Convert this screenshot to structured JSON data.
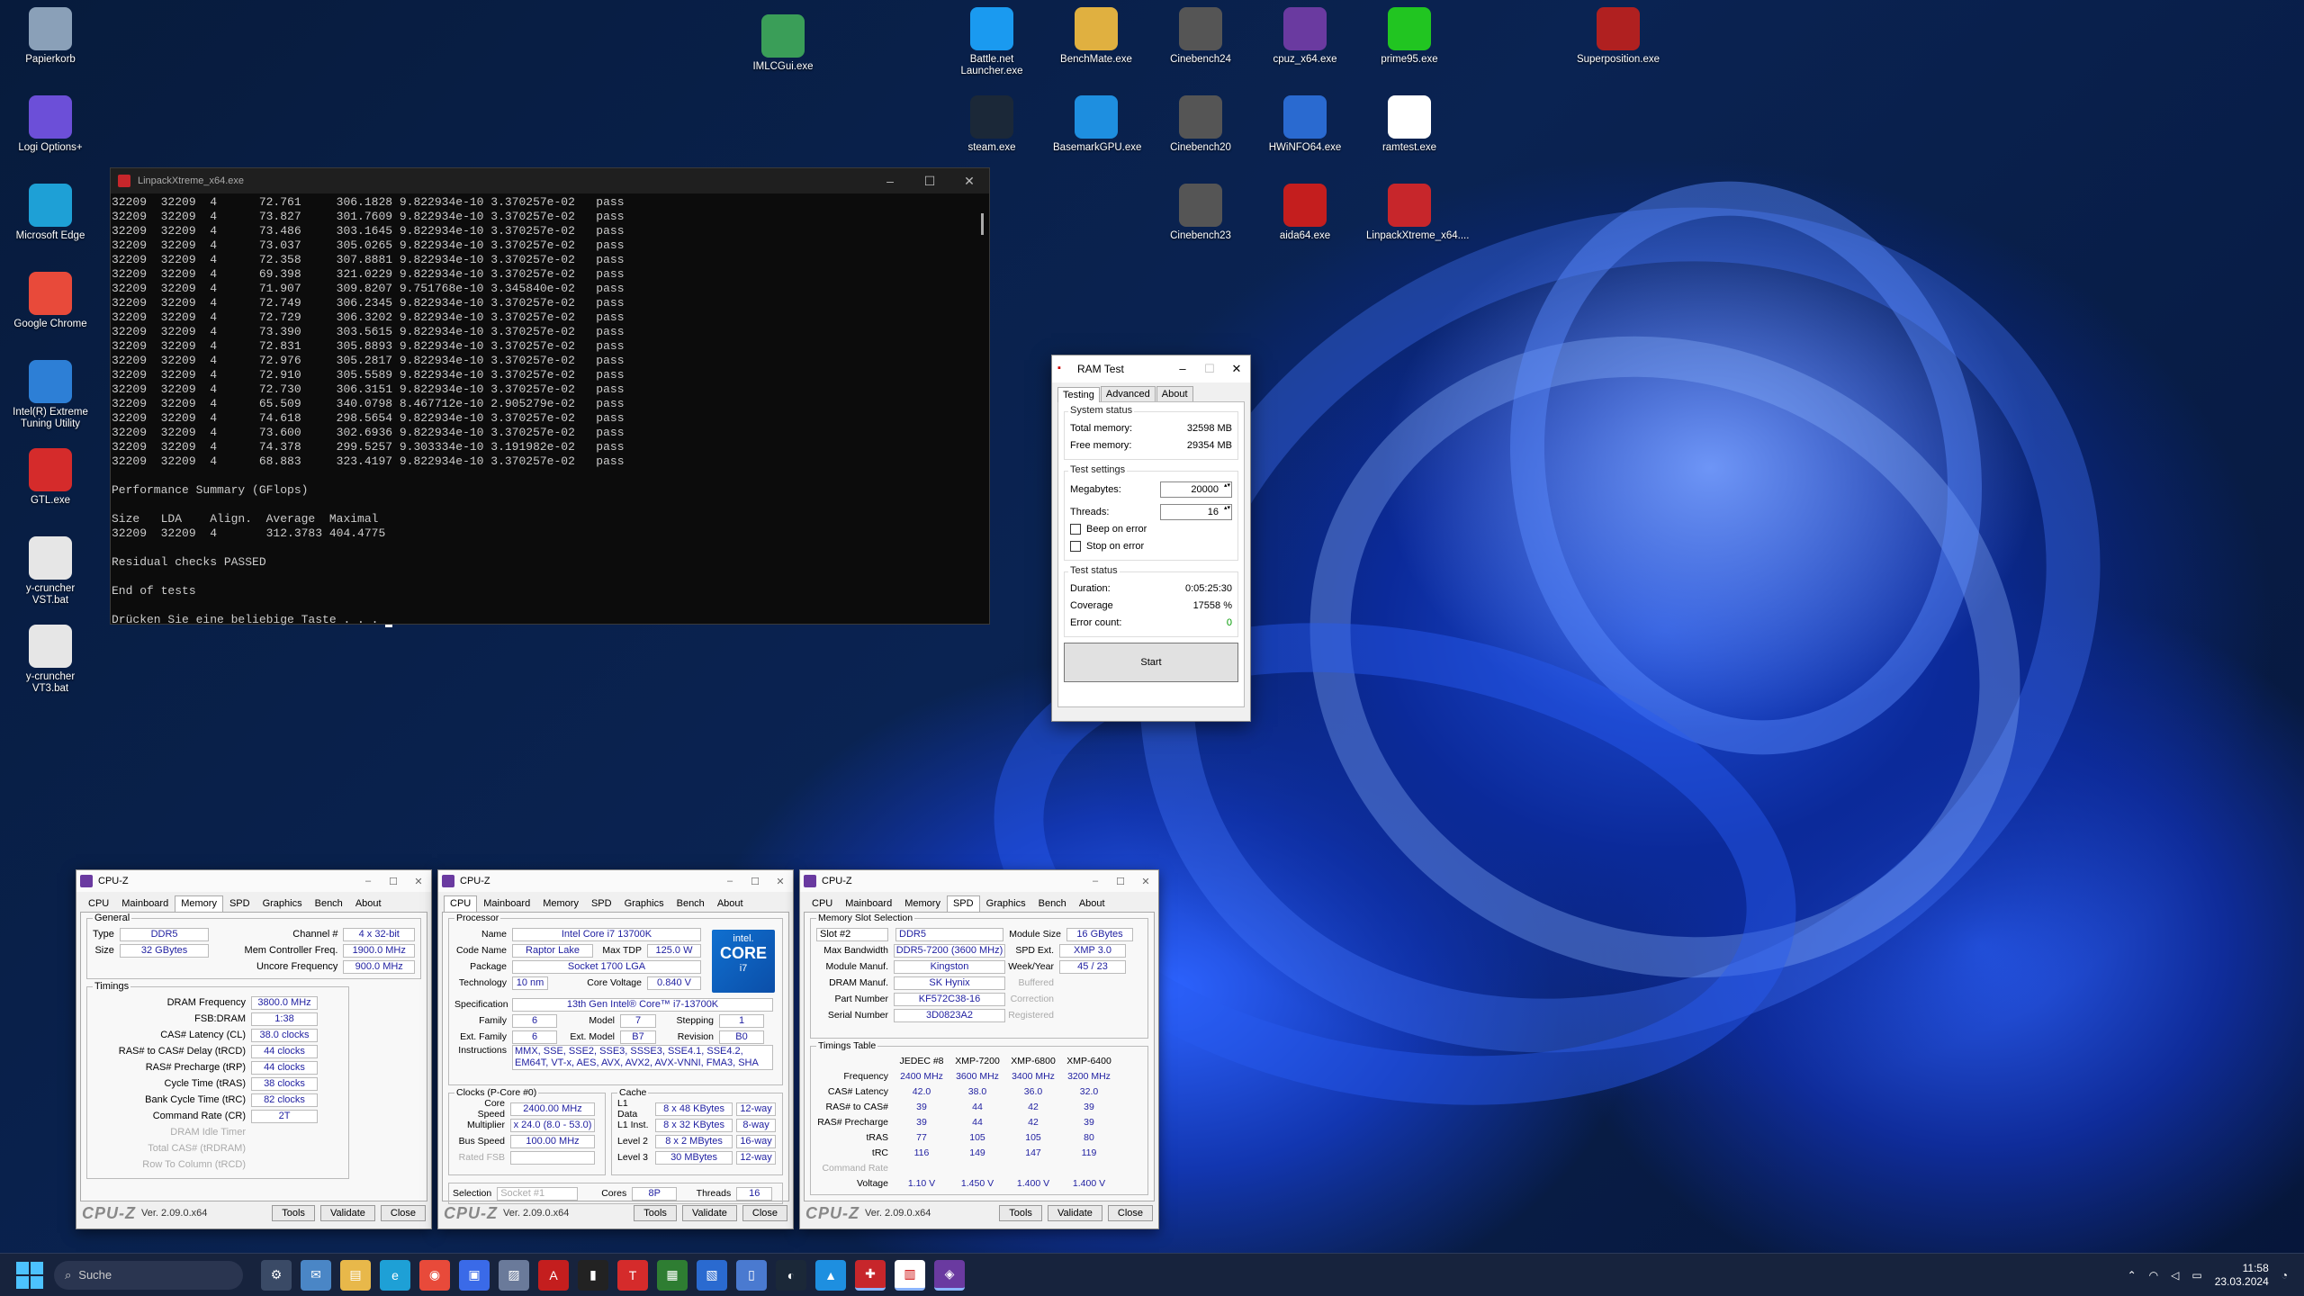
{
  "desktop_icons": [
    {
      "label": "Papierkorb",
      "icon": "recycle-bin-icon",
      "color": "#8aa0b8"
    },
    {
      "label": "Logi Options+",
      "icon": "logi-icon",
      "color": "#6c4fd8"
    },
    {
      "label": "Microsoft Edge",
      "icon": "edge-icon",
      "color": "#1ea0d6"
    },
    {
      "label": "Google Chrome",
      "icon": "chrome-icon",
      "color": "#e84a3a"
    },
    {
      "label": "Intel(R) Extreme Tuning Utility",
      "icon": "xtu-icon",
      "color": "#2d7fd6"
    },
    {
      "label": "GTL.exe",
      "icon": "gtl-icon",
      "color": "#d52b2b"
    },
    {
      "label": "y-cruncher VST.bat",
      "icon": "bat-gear-icon",
      "color": "#e6e6e6"
    },
    {
      "label": "y-cruncher VT3.bat",
      "icon": "bat-gear-icon",
      "color": "#e6e6e6"
    },
    {
      "label": "IMLCGui.exe",
      "icon": "memory-icon",
      "color": "#3a9e58"
    },
    {
      "label": "Battle.net Launcher.exe",
      "icon": "battlenet-icon",
      "color": "#1a9af0"
    },
    {
      "label": "BenchMate.exe",
      "icon": "benchmate-icon",
      "color": "#e0b040"
    },
    {
      "label": "Cinebench24",
      "icon": "cinebench-icon",
      "color": "#555"
    },
    {
      "label": "cpuz_x64.exe",
      "icon": "cpuz-icon",
      "color": "#6a3aa0"
    },
    {
      "label": "prime95.exe",
      "icon": "prime95-icon",
      "color": "#21c521"
    },
    {
      "label": "Superposition.exe",
      "icon": "superposition-icon",
      "color": "#b02020"
    },
    {
      "label": "steam.exe",
      "icon": "steam-icon",
      "color": "#1b2838"
    },
    {
      "label": "BasemarkGPU.exe",
      "icon": "basemark-icon",
      "color": "#1e8fe0"
    },
    {
      "label": "Cinebench20",
      "icon": "cinebench-icon",
      "color": "#555"
    },
    {
      "label": "HWiNFO64.exe",
      "icon": "hwinfo-icon",
      "color": "#2a6ad0"
    },
    {
      "label": "ramtest.exe",
      "icon": "ramtest-icon",
      "color": "#ffffff"
    },
    {
      "label": "Cinebench23",
      "icon": "cinebench-icon",
      "color": "#555"
    },
    {
      "label": "aida64.exe",
      "icon": "aida64-icon",
      "color": "#c41e1e"
    },
    {
      "label": "LinpackXtreme_x64....",
      "icon": "linpack-icon",
      "color": "#c7262b"
    }
  ],
  "terminal": {
    "title": "LinpackXtreme_x64.exe",
    "lines": [
      "32209  32209  4      72.761     306.1828 9.822934e-10 3.370257e-02   pass",
      "32209  32209  4      73.827     301.7609 9.822934e-10 3.370257e-02   pass",
      "32209  32209  4      73.486     303.1645 9.822934e-10 3.370257e-02   pass",
      "32209  32209  4      73.037     305.0265 9.822934e-10 3.370257e-02   pass",
      "32209  32209  4      72.358     307.8881 9.822934e-10 3.370257e-02   pass",
      "32209  32209  4      69.398     321.0229 9.822934e-10 3.370257e-02   pass",
      "32209  32209  4      71.907     309.8207 9.751768e-10 3.345840e-02   pass",
      "32209  32209  4      72.749     306.2345 9.822934e-10 3.370257e-02   pass",
      "32209  32209  4      72.729     306.3202 9.822934e-10 3.370257e-02   pass",
      "32209  32209  4      73.390     303.5615 9.822934e-10 3.370257e-02   pass",
      "32209  32209  4      72.831     305.8893 9.822934e-10 3.370257e-02   pass",
      "32209  32209  4      72.976     305.2817 9.822934e-10 3.370257e-02   pass",
      "32209  32209  4      72.910     305.5589 9.822934e-10 3.370257e-02   pass",
      "32209  32209  4      72.730     306.3151 9.822934e-10 3.370257e-02   pass",
      "32209  32209  4      65.509     340.0798 8.467712e-10 2.905279e-02   pass",
      "32209  32209  4      74.618     298.5654 9.822934e-10 3.370257e-02   pass",
      "32209  32209  4      73.600     302.6936 9.822934e-10 3.370257e-02   pass",
      "32209  32209  4      74.378     299.5257 9.303334e-10 3.191982e-02   pass",
      "32209  32209  4      68.883     323.4197 9.822934e-10 3.370257e-02   pass",
      "",
      "Performance Summary (GFlops)",
      "",
      "Size   LDA    Align.  Average  Maximal",
      "32209  32209  4       312.3783 404.4775",
      "",
      "Residual checks PASSED",
      "",
      "End of tests",
      ""
    ],
    "prompt": "Drücken Sie eine beliebige Taste . . . "
  },
  "ramtest": {
    "title": "RAM Test",
    "tabs": [
      "Testing",
      "Advanced",
      "About"
    ],
    "system_status": "System status",
    "total_memory_label": "Total memory:",
    "total_memory": "32598 MB",
    "free_memory_label": "Free memory:",
    "free_memory": "29354 MB",
    "test_settings": "Test settings",
    "megabytes_label": "Megabytes:",
    "megabytes": "20000",
    "threads_label": "Threads:",
    "threads": "16",
    "beep_label": "Beep on error",
    "stop_label": "Stop on error",
    "test_status": "Test status",
    "duration_label": "Duration:",
    "duration": "0:05:25:30",
    "coverage_label": "Coverage",
    "coverage": "17558 %",
    "errors_label": "Error count:",
    "errors": "0",
    "start": "Start"
  },
  "cpuz_common": {
    "title": "CPU-Z",
    "tabs": [
      "CPU",
      "Mainboard",
      "Memory",
      "SPD",
      "Graphics",
      "Bench",
      "About"
    ],
    "brand": "CPU-Z",
    "version": "Ver. 2.09.0.x64",
    "tools": "Tools",
    "validate": "Validate",
    "close": "Close"
  },
  "cpuz_memory": {
    "general": "General",
    "type_label": "Type",
    "type": "DDR5",
    "size_label": "Size",
    "size": "32 GBytes",
    "channel_label": "Channel #",
    "channel": "4 x 32-bit",
    "mcf_label": "Mem Controller Freq.",
    "mcf": "1900.0 MHz",
    "uncore_label": "Uncore Frequency",
    "uncore": "900.0 MHz",
    "timings": "Timings",
    "rows": [
      {
        "k": "DRAM Frequency",
        "v": "3800.0 MHz"
      },
      {
        "k": "FSB:DRAM",
        "v": "1:38"
      },
      {
        "k": "CAS# Latency (CL)",
        "v": "38.0 clocks"
      },
      {
        "k": "RAS# to CAS# Delay (tRCD)",
        "v": "44 clocks"
      },
      {
        "k": "RAS# Precharge (tRP)",
        "v": "44 clocks"
      },
      {
        "k": "Cycle Time (tRAS)",
        "v": "38 clocks"
      },
      {
        "k": "Bank Cycle Time (tRC)",
        "v": "82 clocks"
      },
      {
        "k": "Command Rate (CR)",
        "v": "2T"
      },
      {
        "k": "DRAM Idle Timer",
        "v": ""
      },
      {
        "k": "Total CAS# (tRDRAM)",
        "v": ""
      },
      {
        "k": "Row To Column (tRCD)",
        "v": ""
      }
    ]
  },
  "cpuz_cpu": {
    "processor": "Processor",
    "name_label": "Name",
    "name": "Intel Core i7 13700K",
    "code_label": "Code Name",
    "code": "Raptor Lake",
    "tdp_label": "Max TDP",
    "tdp": "125.0 W",
    "pkg_label": "Package",
    "pkg": "Socket 1700 LGA",
    "tech_label": "Technology",
    "tech": "10 nm",
    "volt_label": "Core Voltage",
    "volt": "0.840 V",
    "spec_label": "Specification",
    "spec": "13th Gen Intel® Core™ i7-13700K",
    "family_label": "Family",
    "family": "6",
    "model_label": "Model",
    "model": "7",
    "stepping_label": "Stepping",
    "stepping": "1",
    "extfam_label": "Ext. Family",
    "extfam": "6",
    "extmodel_label": "Ext. Model",
    "extmodel": "B7",
    "rev_label": "Revision",
    "rev": "B0",
    "instr_label": "Instructions",
    "instr": "MMX, SSE, SSE2, SSE3, SSSE3, SSE4.1, SSE4.2, EM64T, VT-x, AES, AVX, AVX2, AVX-VNNI, FMA3, SHA",
    "clocks": "Clocks (P-Core #0)",
    "speed_label": "Core Speed",
    "speed": "2400.00 MHz",
    "mult_label": "Multiplier",
    "mult": "x 24.0 (8.0 - 53.0)",
    "bus_label": "Bus Speed",
    "bus": "100.00 MHz",
    "fsb_label": "Rated FSB",
    "cache": "Cache",
    "l1d_label": "L1 Data",
    "l1d": "8 x 48 KBytes",
    "l1d_w": "12-way",
    "l1i_label": "L1 Inst.",
    "l1i": "8 x 32 KBytes",
    "l1i_w": "8-way",
    "l2_label": "Level 2",
    "l2": "8 x 2 MBytes",
    "l2_w": "16-way",
    "l3_label": "Level 3",
    "l3": "30 MBytes",
    "l3_w": "12-way",
    "sel_label": "Selection",
    "sel": "Socket #1",
    "cores_label": "Cores",
    "cores": "8P",
    "threads_label": "Threads",
    "threads": "16",
    "intel_brand": "intel.",
    "intel_core": "CORE",
    "intel_tier": "i7"
  },
  "cpuz_spd": {
    "slot_group": "Memory Slot Selection",
    "slot": "Slot #2",
    "type": "DDR5",
    "modsize_label": "Module Size",
    "modsize": "16 GBytes",
    "bw_label": "Max Bandwidth",
    "bw": "DDR5-7200 (3600 MHz)",
    "spdext_label": "SPD Ext.",
    "spdext": "XMP 3.0",
    "manuf_label": "Module Manuf.",
    "manuf": "Kingston",
    "week_label": "Week/Year",
    "week": "45 / 23",
    "dram_label": "DRAM Manuf.",
    "dram": "SK Hynix",
    "buffered": "Buffered",
    "part_label": "Part Number",
    "part": "KF572C38-16",
    "correction": "Correction",
    "serial_label": "Serial Number",
    "serial": "3D0823A2",
    "registered": "Registered",
    "timings_table": "Timings Table",
    "cols": [
      "JEDEC #8",
      "XMP-7200",
      "XMP-6800",
      "XMP-6400"
    ],
    "rows": [
      {
        "k": "Frequency",
        "v": [
          "2400 MHz",
          "3600 MHz",
          "3400 MHz",
          "3200 MHz"
        ]
      },
      {
        "k": "CAS# Latency",
        "v": [
          "42.0",
          "38.0",
          "36.0",
          "32.0"
        ]
      },
      {
        "k": "RAS# to CAS#",
        "v": [
          "39",
          "44",
          "42",
          "39"
        ]
      },
      {
        "k": "RAS# Precharge",
        "v": [
          "39",
          "44",
          "42",
          "39"
        ]
      },
      {
        "k": "tRAS",
        "v": [
          "77",
          "105",
          "105",
          "80"
        ]
      },
      {
        "k": "tRC",
        "v": [
          "116",
          "149",
          "147",
          "119"
        ]
      },
      {
        "k": "Command Rate",
        "v": [
          "",
          "",
          "",
          ""
        ]
      },
      {
        "k": "Voltage",
        "v": [
          "1.10 V",
          "1.450 V",
          "1.400 V",
          "1.400 V"
        ]
      }
    ]
  },
  "taskbar": {
    "search_placeholder": "Suche",
    "time": "11:58",
    "date": "23.03.2024"
  }
}
